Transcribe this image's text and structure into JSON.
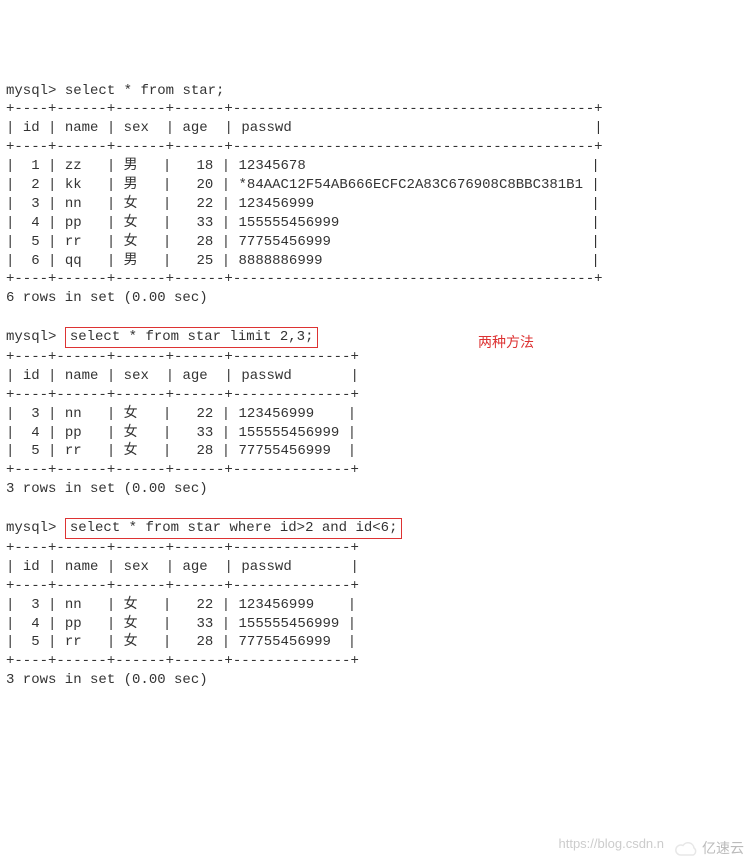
{
  "prompt": "mysql>",
  "queries": {
    "q1": "select * from star;",
    "q2": "select * from star limit 2,3;",
    "q3": "select * from star where id>2 and id<6;"
  },
  "headers": [
    "id",
    "name",
    "sex",
    "age",
    "passwd"
  ],
  "table1": {
    "rows": [
      {
        "id": "1",
        "name": "zz",
        "sex": "男",
        "age": "18",
        "passwd": "12345678"
      },
      {
        "id": "2",
        "name": "kk",
        "sex": "男",
        "age": "20",
        "passwd": "*84AAC12F54AB666ECFC2A83C676908C8BBC381B1"
      },
      {
        "id": "3",
        "name": "nn",
        "sex": "女",
        "age": "22",
        "passwd": "123456999"
      },
      {
        "id": "4",
        "name": "pp",
        "sex": "女",
        "age": "33",
        "passwd": "155555456999"
      },
      {
        "id": "5",
        "name": "rr",
        "sex": "女",
        "age": "28",
        "passwd": "77755456999"
      },
      {
        "id": "6",
        "name": "qq",
        "sex": "男",
        "age": "25",
        "passwd": "8888886999"
      }
    ],
    "summary": "6 rows in set (0.00 sec)"
  },
  "table2": {
    "rows": [
      {
        "id": "3",
        "name": "nn",
        "sex": "女",
        "age": "22",
        "passwd": "123456999"
      },
      {
        "id": "4",
        "name": "pp",
        "sex": "女",
        "age": "33",
        "passwd": "155555456999"
      },
      {
        "id": "5",
        "name": "rr",
        "sex": "女",
        "age": "28",
        "passwd": "77755456999"
      }
    ],
    "summary": "3 rows in set (0.00 sec)"
  },
  "table3": {
    "rows": [
      {
        "id": "3",
        "name": "nn",
        "sex": "女",
        "age": "22",
        "passwd": "123456999"
      },
      {
        "id": "4",
        "name": "pp",
        "sex": "女",
        "age": "33",
        "passwd": "155555456999"
      },
      {
        "id": "5",
        "name": "rr",
        "sex": "女",
        "age": "28",
        "passwd": "77755456999"
      }
    ],
    "summary": "3 rows in set (0.00 sec)"
  },
  "separators": {
    "wide": "+----+------+------+------+-------------------------------------------+",
    "narrow": "+----+------+------+------+--------------+"
  },
  "annotation": "两种方法",
  "watermark": "https://blog.csdn.n",
  "logo_text": "亿速云"
}
